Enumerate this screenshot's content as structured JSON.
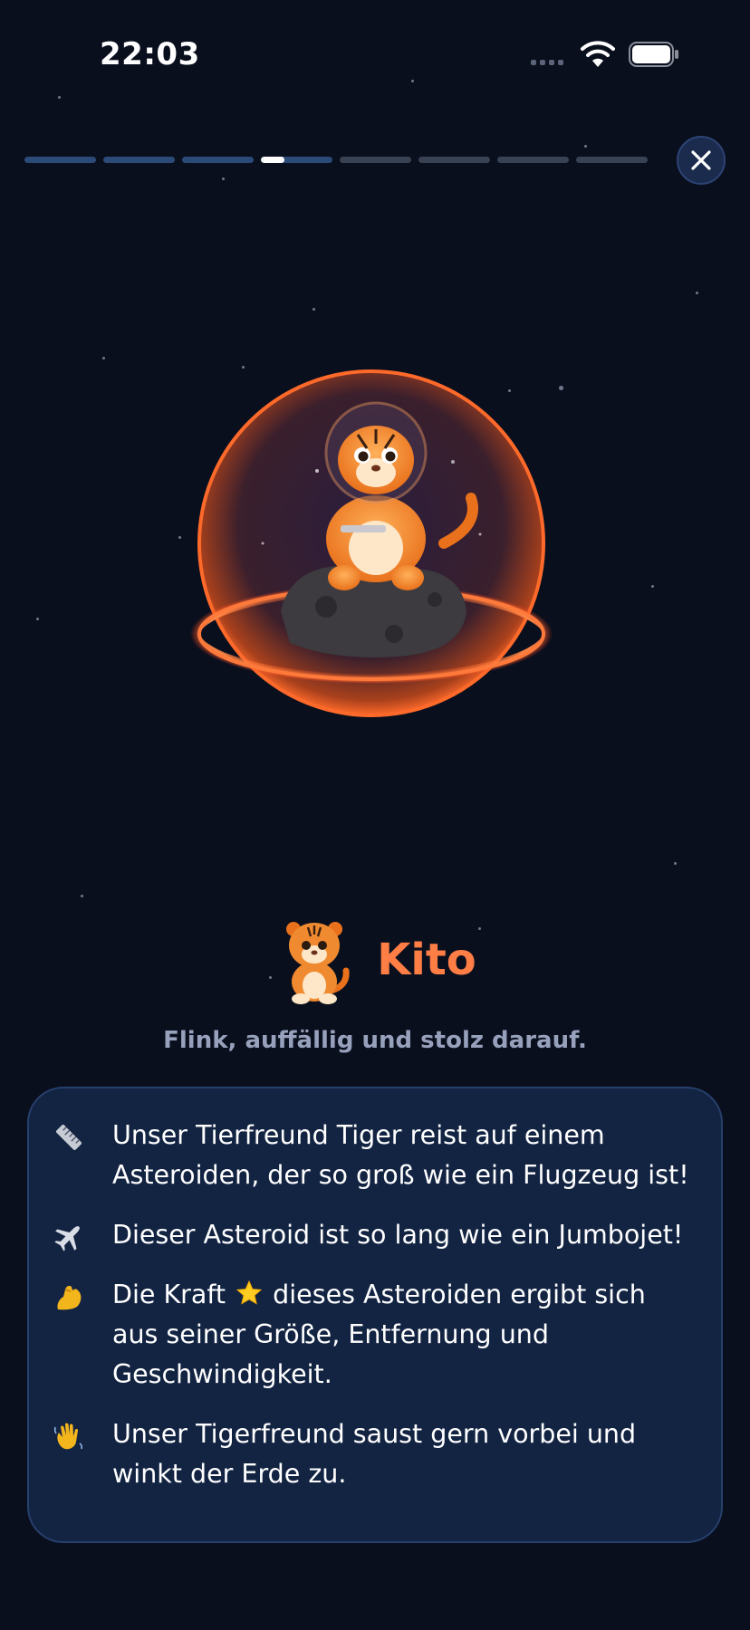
{
  "status_bar": {
    "time": "22:03"
  },
  "progress": {
    "total_steps": 8,
    "completed_steps": 3,
    "current_step_fill": 0.33
  },
  "pet": {
    "name": "Kito",
    "tagline": "Flink, auffällig und stolz darauf."
  },
  "facts": [
    {
      "icon": "ruler-icon",
      "text": "Unser Tierfreund Tiger reist auf einem Asteroiden, der so groß wie ein Flugzeug ist!"
    },
    {
      "icon": "airplane-icon",
      "text": "Dieser Asteroid ist so lang wie ein Jumbojet!"
    },
    {
      "icon": "flexed-biceps-icon",
      "text_before": "Die Kraft",
      "text_after": "dieses Asteroiden ergibt sich aus seiner Größe, Entfernung und Geschwindigkeit."
    },
    {
      "icon": "waving-hand-icon",
      "text": "Unser Tigerfreund saust gern vorbei und winkt der Erde zu."
    }
  ],
  "colors": {
    "background": "#0a0f1e",
    "accent": "#ff7e45",
    "card": "#132443",
    "tagline": "#97a1bc"
  }
}
